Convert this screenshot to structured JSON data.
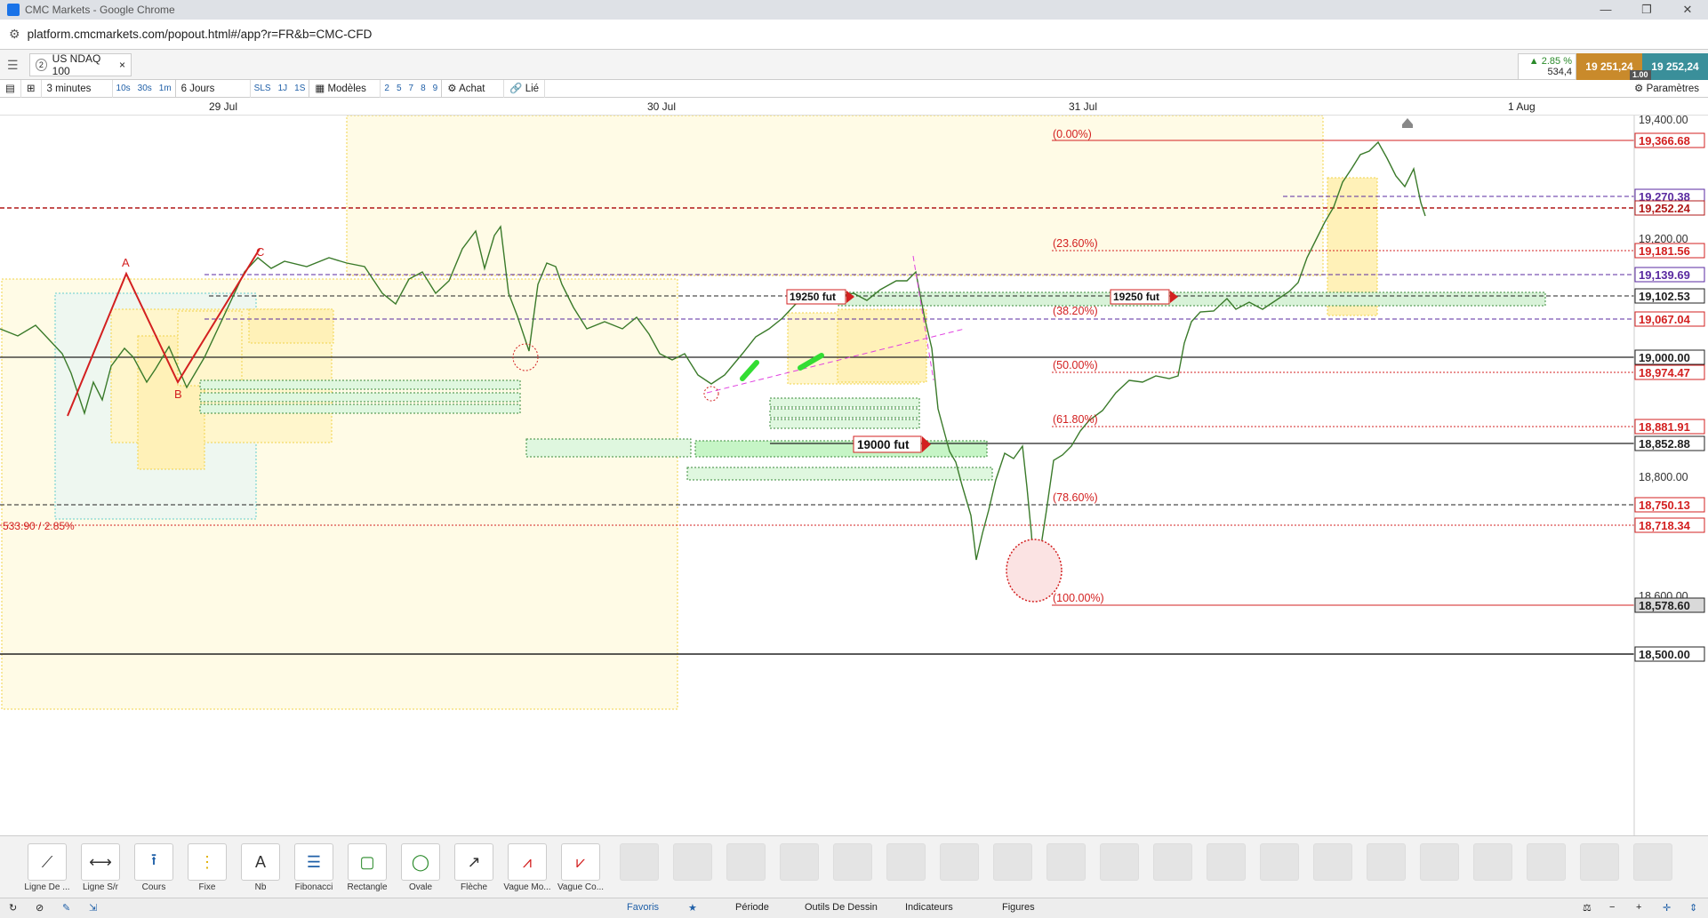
{
  "window": {
    "title": "CMC Markets - Google Chrome",
    "url": "platform.cmcmarkets.com/popout.html#/app?r=FR&b=CMC-CFD"
  },
  "instrument": {
    "count": "2",
    "name": "US NDAQ 100",
    "change_pct": "2.85 %",
    "change_val": "534,4",
    "sell": "19 251,24",
    "buy": "19 252,24",
    "spread": "1.00"
  },
  "toolbar": {
    "interval": "3 minutes",
    "quick_intervals": [
      "10s",
      "30s",
      "1m"
    ],
    "range": "6 Jours",
    "quick_ranges": [
      "SLS",
      "1J",
      "1S"
    ],
    "models": "Modèles",
    "numbers": [
      "2",
      "5",
      "7",
      "8",
      "9"
    ],
    "buy": "Achat",
    "linked": "Lié",
    "params": "Paramètres"
  },
  "dates": [
    "29 Jul",
    "30 Jul",
    "31 Jul",
    "1 Aug"
  ],
  "chart_data": {
    "type": "line",
    "price_ticks": [
      "19,400.00",
      "19,200.00",
      "18,800.00",
      "18,600.00",
      "18,500.00"
    ],
    "price_labels": [
      {
        "text": "19,366.68",
        "color": "#d32020"
      },
      {
        "text": "19,270.38",
        "color": "#5a2aa0"
      },
      {
        "text": "19,252.24",
        "color": "#b01818"
      },
      {
        "text": "19,181.56",
        "color": "#d32020"
      },
      {
        "text": "19,139.69",
        "color": "#5a2aa0"
      },
      {
        "text": "19,102.53",
        "color": "#222222"
      },
      {
        "text": "19,067.04",
        "color": "#d32020"
      },
      {
        "text": "19,000.00",
        "color": "#222222"
      },
      {
        "text": "18,974.47",
        "color": "#d32020"
      },
      {
        "text": "18,881.91",
        "color": "#d32020"
      },
      {
        "text": "18,852.88",
        "color": "#222222"
      },
      {
        "text": "18,750.13",
        "color": "#d32020"
      },
      {
        "text": "18,718.34",
        "color": "#d32020"
      },
      {
        "text": "18,578.60",
        "color": "#222222"
      },
      {
        "text": "18,500.00",
        "color": "#222222"
      }
    ],
    "fib_levels": [
      "(0.00%)",
      "(23.60%)",
      "(38.20%)",
      "(50.00%)",
      "(61.80%)",
      "(78.60%)",
      "(100.00%)"
    ],
    "annotations": {
      "wave_a": "A",
      "wave_b": "B",
      "wave_c": "C",
      "fut1": "19250 fut",
      "fut2": "19250 fut",
      "fut3": "19000 fut",
      "range_text": "533.90 / 2.85%"
    }
  },
  "tools": [
    "Ligne De ...",
    "Ligne S/r",
    "Cours",
    "Fixe",
    "Nb",
    "Fibonacci",
    "Rectangle",
    "Ovale",
    "Flèche",
    "Vague Mo...",
    "Vague Co..."
  ],
  "status_tabs": [
    "Favoris",
    "Période",
    "Outils De Dessin",
    "Indicateurs",
    "Figures"
  ]
}
